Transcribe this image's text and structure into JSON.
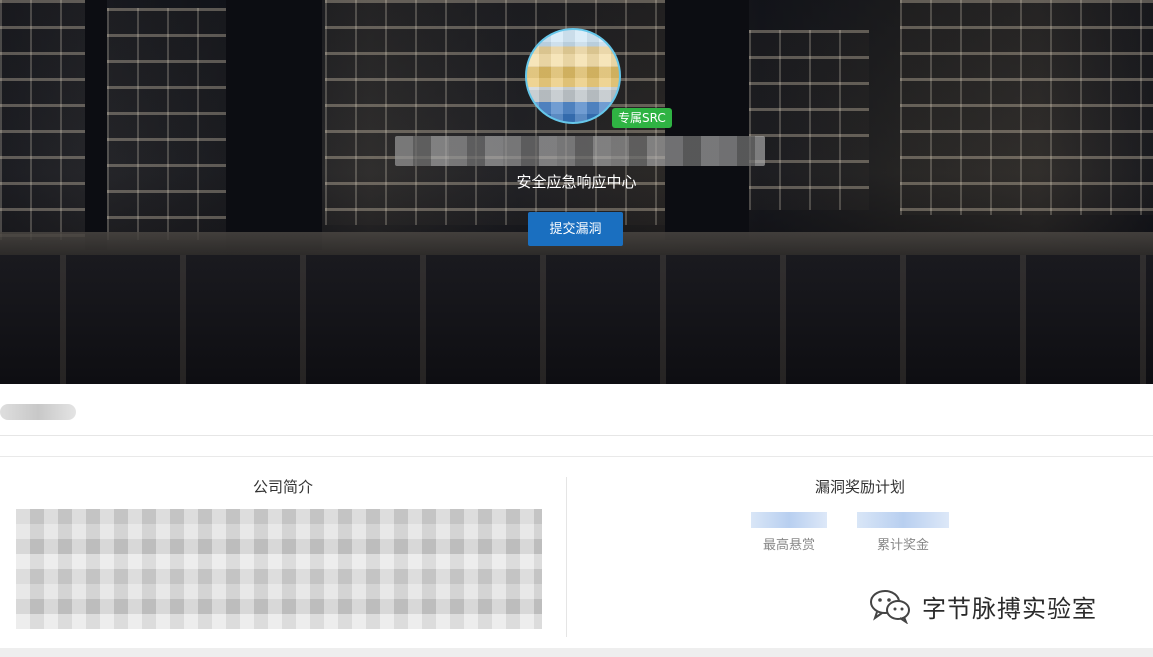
{
  "hero": {
    "badge": "专属SRC",
    "subtitle": "安全应急响应中心",
    "submit_label": "提交漏洞"
  },
  "company": {
    "title": "公司简介"
  },
  "bounty": {
    "title": "漏洞奖励计划",
    "stats": [
      {
        "label": "最高悬赏"
      },
      {
        "label": "累计奖金"
      }
    ]
  },
  "watermark": {
    "text": "字节脉搏实验室",
    "icon": "wechat-icon"
  },
  "colors": {
    "badge_green": "#2fb343",
    "button_blue": "#1a6fc0"
  }
}
